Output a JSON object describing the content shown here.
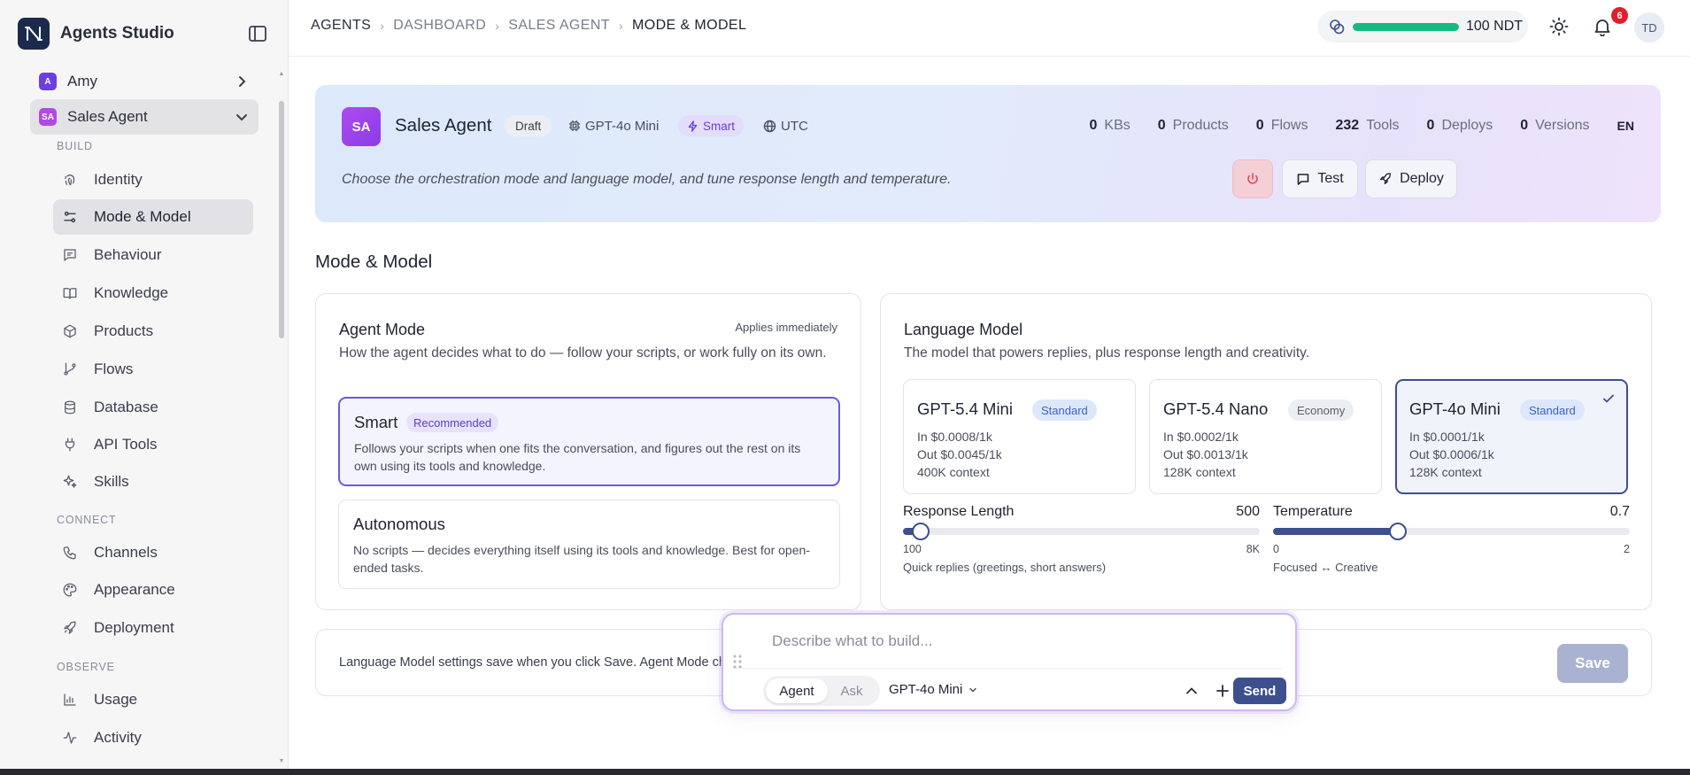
{
  "app": {
    "title": "Agents Studio"
  },
  "sidebar": {
    "agents": [
      {
        "initial": "A",
        "name": "Amy",
        "color": "#6b3fe0"
      },
      {
        "initial": "SA",
        "name": "Sales Agent",
        "color": "#b14ae6"
      }
    ],
    "sections": [
      {
        "label": "BUILD",
        "items": [
          {
            "label": "Identity",
            "icon": "fingerprint-icon"
          },
          {
            "label": "Mode & Model",
            "icon": "sliders-icon",
            "active": true
          },
          {
            "label": "Behaviour",
            "icon": "message-square-icon"
          },
          {
            "label": "Knowledge",
            "icon": "book-icon"
          },
          {
            "label": "Products",
            "icon": "package-icon"
          },
          {
            "label": "Flows",
            "icon": "git-branch-icon"
          },
          {
            "label": "Database",
            "icon": "database-icon"
          },
          {
            "label": "API Tools",
            "icon": "plug-icon"
          },
          {
            "label": "Skills",
            "icon": "sparkles-icon"
          }
        ]
      },
      {
        "label": "CONNECT",
        "items": [
          {
            "label": "Channels",
            "icon": "phone-icon"
          },
          {
            "label": "Appearance",
            "icon": "palette-icon"
          },
          {
            "label": "Deployment",
            "icon": "rocket-icon"
          }
        ]
      },
      {
        "label": "OBSERVE",
        "items": [
          {
            "label": "Usage",
            "icon": "bar-chart-icon"
          },
          {
            "label": "Activity",
            "icon": "activity-icon"
          }
        ]
      }
    ]
  },
  "topbar": {
    "breadcrumb": [
      "AGENTS",
      "DASHBOARD",
      "SALES AGENT",
      "MODE & MODEL"
    ],
    "credits": {
      "label": "100 NDT",
      "level": 1.0
    },
    "notifications": "6",
    "user_initials": "TD"
  },
  "hero": {
    "initials": "SA",
    "name": "Sales Agent",
    "status": "Draft",
    "model": "GPT-4o Mini",
    "mode": "Smart",
    "timezone": "UTC",
    "stats": [
      {
        "value": "0",
        "label": "KBs"
      },
      {
        "value": "0",
        "label": "Products"
      },
      {
        "value": "0",
        "label": "Flows"
      },
      {
        "value": "232",
        "label": "Tools"
      },
      {
        "value": "0",
        "label": "Deploys"
      },
      {
        "value": "0",
        "label": "Versions"
      }
    ],
    "language": "EN",
    "description": "Choose the orchestration mode and language model, and tune response length and temperature.",
    "test_label": "Test",
    "deploy_label": "Deploy"
  },
  "main": {
    "section_title": "Mode & Model"
  },
  "agent_mode": {
    "title": "Agent Mode",
    "note": "Applies immediately",
    "description": "How the agent decides what to do — follow your scripts, or work fully on its own.",
    "options": [
      {
        "name": "Smart",
        "tag": "Recommended",
        "text": "Follows your scripts when one fits the conversation, and figures out the rest on its own using its tools and knowledge.",
        "selected": true
      },
      {
        "name": "Autonomous",
        "tag": "",
        "text": "No scripts — decides everything itself using its tools and knowledge. Best for open-ended tasks.",
        "selected": false
      }
    ]
  },
  "language_model": {
    "title": "Language Model",
    "description": "The model that powers replies, plus response length and creativity.",
    "models": [
      {
        "name": "GPT-5.4 Mini",
        "tier": "Standard",
        "in": "In $0.0008/1k",
        "out": "Out $0.0045/1k",
        "context": "400K context",
        "selected": false
      },
      {
        "name": "GPT-5.4 Nano",
        "tier": "Economy",
        "in": "In $0.0002/1k",
        "out": "Out $0.0013/1k",
        "context": "128K context",
        "selected": false
      },
      {
        "name": "GPT-4o Mini",
        "tier": "Standard",
        "in": "In $0.0001/1k",
        "out": "Out $0.0006/1k",
        "context": "128K context",
        "selected": true
      }
    ],
    "response_length": {
      "label": "Response Length",
      "value": "500",
      "level": 0.05,
      "min": "100",
      "max": "8K",
      "hint": "Quick replies (greetings, short answers)"
    },
    "temperature": {
      "label": "Temperature",
      "value": "0.7",
      "level": 0.35,
      "min": "0",
      "max": "2",
      "hint": "Focused ↔ Creative"
    }
  },
  "footer": {
    "text": "Language Model settings save when you click Save. Agent Mode changes apply immediately.",
    "save_label": "Save"
  },
  "composer": {
    "placeholder": "Describe what to build...",
    "modes": [
      "Agent",
      "Ask"
    ],
    "active_mode": "Agent",
    "model": "GPT-4o Mini",
    "send_label": "Send"
  }
}
